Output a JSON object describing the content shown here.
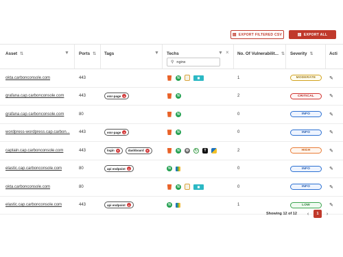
{
  "toolbar": {
    "export_filtered_label": "EXPORT FILTERED CSV",
    "export_all_label": "EXPORT ALL"
  },
  "columns": {
    "asset": "Asset",
    "ports": "Ports",
    "tags": "Tags",
    "techs": "Techs",
    "vulns": "No. Of Vulnerabilit...",
    "severity": "Severity",
    "actions": "Acti"
  },
  "tech_search": {
    "value": "nginx"
  },
  "rows": [
    {
      "asset": "okta.carbonconsole.com",
      "port": "443",
      "vulns": "1",
      "severity": "MODERATE"
    },
    {
      "asset": "grafana.cap.carbonconsole.com",
      "port": "443",
      "tags": [
        "emr-page"
      ],
      "vulns": "2",
      "severity": "CRITICAL"
    },
    {
      "asset": "grafana.cap.carbonconsole.com",
      "port": "80",
      "vulns": "0",
      "severity": "INFO"
    },
    {
      "asset": "wordpress-wordpress.cap.carbon...",
      "port": "443",
      "tags": [
        "emr-page"
      ],
      "vulns": "0",
      "severity": "INFO"
    },
    {
      "asset": "captain.cap.carbonconsole.com",
      "port": "443",
      "tags": [
        "login",
        "dashboard"
      ],
      "vulns": "2",
      "severity": "HIGH"
    },
    {
      "asset": "elastic.cap.carbonconsole.com",
      "port": "80",
      "tags": [
        "api endpoint"
      ],
      "vulns": "0",
      "severity": "INFO"
    },
    {
      "asset": "okta.carbonconsole.com",
      "port": "80",
      "vulns": "0",
      "severity": "INFO"
    },
    {
      "asset": "elastic.cap.carbonconsole.com",
      "port": "443",
      "tags": [
        "api endpoint"
      ],
      "vulns": "1",
      "severity": "LOW"
    }
  ],
  "footer": {
    "showing": "Showing 12 of 12",
    "current_page": "1"
  },
  "colors": {
    "accent": "#c0392b"
  }
}
